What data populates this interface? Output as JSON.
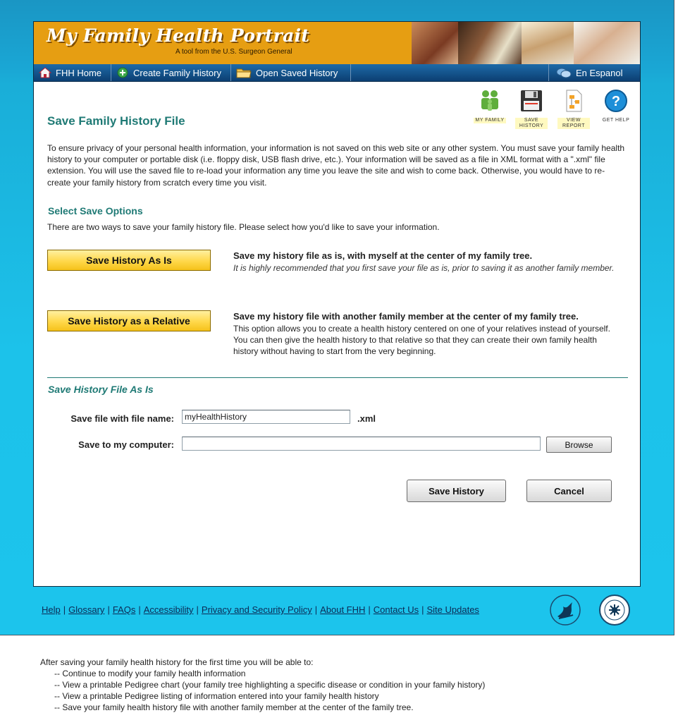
{
  "banner": {
    "title": "My Family Health Portrait",
    "subtitle": "A tool from the U.S. Surgeon General"
  },
  "nav": {
    "home": "FHH Home",
    "create": "Create Family History",
    "open": "Open Saved History",
    "espanol": "En Espanol"
  },
  "top_icons": [
    {
      "label": "MY FAMILY",
      "icon": "family-icon"
    },
    {
      "label": "SAVE HISTORY",
      "icon": "floppy-disk-icon"
    },
    {
      "label": "VIEW REPORT",
      "icon": "report-icon"
    },
    {
      "label": "GET HELP",
      "icon": "help-icon"
    }
  ],
  "page_title": "Save Family History File",
  "intro": "To ensure privacy of your personal health information, your information is not saved on this web site or any other system.  You must save your family health history to your computer or portable disk (i.e. floppy disk, USB flash drive, etc.).  Your information will be saved as a file in XML format with a \".xml\" file extension.  You will use the saved file to re-load your information any time you leave the site and wish to come back.  Otherwise, you would have to re-create your family history from scratch every time you visit.",
  "options": {
    "heading": "Select Save Options",
    "description": "There are two ways to save your family history file.  Please select how you'd like to save your information.",
    "as_is": {
      "button": "Save History As Is",
      "title": "Save my history file as is, with myself at the center of my family tree.",
      "text": "It is highly recommended that you first save your file as is, prior to saving it as another family member."
    },
    "relative": {
      "button": "Save History as a Relative",
      "title": "Save my history file with another family member at the center of my family tree.",
      "text": "This option allows you to create a health history centered on one of your relatives instead of yourself. You can then give the health history to that relative so that they can create their own family health history without having to start from the very beginning."
    }
  },
  "form": {
    "heading": "Save History File As Is",
    "filename_label": "Save file with file name:",
    "filename_value": "myHealthHistory",
    "extension": ".xml",
    "computer_label": "Save to my computer:",
    "computer_value": "",
    "browse": "Browse",
    "save": "Save History",
    "cancel": "Cancel"
  },
  "footer": {
    "links": [
      "Help",
      "Glossary",
      "FAQs",
      "Accessibility",
      "Privacy and Security Policy",
      "About FHH",
      "Contact Us",
      "Site Updates"
    ]
  },
  "after": {
    "intro": "After saving your family health history for the first time you will be able to:",
    "items": [
      "-- Continue to modify your family health information",
      "-- View a printable Pedigree chart (your family tree highlighting a specific disease or condition in your family history)",
      "-- View a printable Pedigree listing of information entered into your family health history",
      "-- Save your family health history file with another family member at the center of the family tree."
    ]
  },
  "colors": {
    "accent": "#1f7a75",
    "banner": "#e69e12",
    "nav": "#0c3f72",
    "button_yellow": "#ffd84a",
    "background": "#1cc2ea"
  }
}
